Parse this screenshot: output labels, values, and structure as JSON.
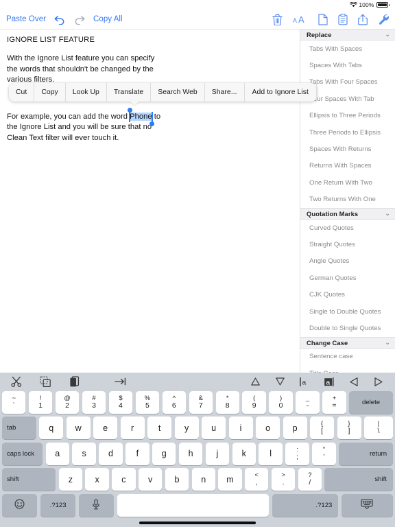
{
  "statusbar": {
    "wifi_icon": "wifi-icon",
    "battery_percent": "100%",
    "battery_icon": "battery-full-icon"
  },
  "toolbar": {
    "paste_over_label": "Paste Over",
    "undo_icon": "undo-arrow-icon",
    "redo_icon": "redo-arrow-icon",
    "copy_all_label": "Copy All",
    "right_icons": [
      {
        "name": "trash-icon",
        "label": "Trash"
      },
      {
        "name": "text-size-icon",
        "label": "AA"
      },
      {
        "name": "document-icon",
        "label": "Document"
      },
      {
        "name": "clipboard-icon",
        "label": "Clipboard"
      },
      {
        "name": "share-icon",
        "label": "Share"
      },
      {
        "name": "wrench-icon",
        "label": "Settings"
      }
    ],
    "accent_color": "#3478f6"
  },
  "document": {
    "title": "IGNORE LIST FEATURE",
    "paragraph1": "With the Ignore List feature you can specify\nthe words that shouldn't be changed by the\nvarious filters.",
    "paragraph2_before": "For example, you can add the word ",
    "selected_word": "Phone",
    "paragraph2_after": " to\nthe Ignore List and you will be sure that no\nClean Text filter will ever touch it.",
    "selection_color": "#b4d5fe",
    "handle_color": "#2b7cf8"
  },
  "context_menu": {
    "items": [
      {
        "label": "Cut"
      },
      {
        "label": "Copy"
      },
      {
        "label": "Look Up"
      },
      {
        "label": "Translate"
      },
      {
        "label": "Search Web"
      },
      {
        "label": "Share..."
      },
      {
        "label": "Add to Ignore List"
      }
    ]
  },
  "sidebar": {
    "sections": [
      {
        "title": "Replace",
        "chevron": "chevron-down-icon",
        "items": [
          "Tabs With Spaces",
          "Spaces With Tabs",
          "Tabs With Four Spaces",
          "Four Spaces With Tab",
          "Ellipsis to Three Periods",
          "Three Periods to Ellipsis",
          "Spaces With Returns",
          "Returns With Spaces",
          "One Return With Two",
          "Two Returns With One"
        ]
      },
      {
        "title": "Quotation Marks",
        "chevron": "chevron-down-icon",
        "items": [
          "Curved Quotes",
          "Straight Quotes",
          "Angle Quotes",
          "German Quotes",
          "CJK Quotes",
          "Single to Double Quotes",
          "Double to Single Quotes"
        ]
      },
      {
        "title": "Change Case",
        "chevron": "chevron-down-icon",
        "items": [
          "Sentence case",
          "Title Case"
        ]
      }
    ]
  },
  "keyboard": {
    "toolbar": {
      "left_icons": [
        {
          "name": "cut-scissors-icon"
        },
        {
          "name": "copy-icon"
        },
        {
          "name": "paste-icon"
        },
        {
          "name": "tab-indent-icon"
        }
      ],
      "right_icons": [
        {
          "name": "triangle-up-icon"
        },
        {
          "name": "triangle-down-icon"
        },
        {
          "name": "select-left-text-icon"
        },
        {
          "name": "select-right-text-icon"
        },
        {
          "name": "triangle-left-icon"
        },
        {
          "name": "triangle-right-icon"
        }
      ]
    },
    "row_numbers": [
      {
        "up": "~",
        "lo": "`"
      },
      {
        "up": "!",
        "lo": "1"
      },
      {
        "up": "@",
        "lo": "2"
      },
      {
        "up": "#",
        "lo": "3"
      },
      {
        "up": "$",
        "lo": "4"
      },
      {
        "up": "%",
        "lo": "5"
      },
      {
        "up": "^",
        "lo": "6"
      },
      {
        "up": "&",
        "lo": "7"
      },
      {
        "up": "*",
        "lo": "8"
      },
      {
        "up": "(",
        "lo": "9"
      },
      {
        "up": ")",
        "lo": "0"
      },
      {
        "up": "_",
        "lo": "-"
      },
      {
        "up": "+",
        "lo": "="
      }
    ],
    "delete_label": "delete",
    "row_top": [
      "q",
      "w",
      "e",
      "r",
      "t",
      "y",
      "u",
      "i",
      "o",
      "p"
    ],
    "row_top_dual": [
      {
        "up": "{",
        "lo": "["
      },
      {
        "up": "}",
        "lo": "]"
      },
      {
        "up": "|",
        "lo": "\\"
      }
    ],
    "tab_label": "tab",
    "row_home": [
      "a",
      "s",
      "d",
      "f",
      "g",
      "h",
      "j",
      "k",
      "l"
    ],
    "row_home_dual": [
      {
        "up": ":",
        "lo": ";"
      },
      {
        "up": "”",
        "lo": "’"
      }
    ],
    "caps_label": "caps lock",
    "return_label": "return",
    "row_bottom": [
      "z",
      "x",
      "c",
      "v",
      "b",
      "n",
      "m"
    ],
    "row_bottom_dual": [
      {
        "up": "<",
        "lo": ","
      },
      {
        "up": ">",
        "lo": "."
      },
      {
        "up": "?",
        "lo": "/"
      }
    ],
    "shift_left_label": "shift",
    "shift_right_label": "shift",
    "emoji_icon": "emoji-smiley-icon",
    "numeric_left_label": ".?123",
    "mic_icon": "microphone-icon",
    "spacebar_label": "",
    "numeric_right_label": ".?123",
    "dismiss_icon": "hide-keyboard-icon"
  }
}
